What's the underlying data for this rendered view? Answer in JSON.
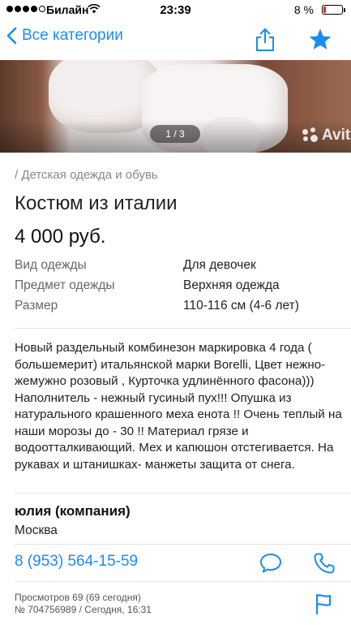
{
  "status_bar": {
    "carrier": "Билайн",
    "time": "23:39",
    "battery": "8 %",
    "battery_level": 0.08
  },
  "nav": {
    "back_label": "Все категории",
    "back_icon": "chevron-left-icon",
    "share_icon": "share-icon",
    "favorite_icon": "star-icon",
    "accent_color": "#1a8cf0"
  },
  "gallery": {
    "counter": "1 / 3",
    "watermark": "Avit"
  },
  "listing": {
    "breadcrumb": "/ Детская одежда и обувь",
    "title": "Костюм из италии",
    "price": "4 000 руб.",
    "params": [
      {
        "label": "Вид одежды",
        "value": "Для девочек"
      },
      {
        "label": "Предмет одежды",
        "value": "Верхняя одежда"
      },
      {
        "label": "Размер",
        "value": "110-116 см (4-6 лет)"
      }
    ],
    "description": "Новый раздельный комбинезон маркировка 4 года ( большемерит) итальянской марки Borelli, Цвет нежно-жемужно розовый , Курточка удлинённого фасона))) Наполнитель - нежный гусиный пух!!! Опушка из натурального крашенного меха енота !! Очень теплый на наши морозы до - 30 !! Материал грязе и водоотталкивающий. Мех и капюшон отстегивается. На рукавах и штанишках- манжеты защита от снега."
  },
  "seller": {
    "name": "юлия (компания)",
    "city": "Москва",
    "phone": "8 (953) 564-15-59"
  },
  "meta": {
    "views": "Просмотров 69 (69 сегодня)",
    "id_date": "№ 704756989 / Сегодня, 16:31"
  }
}
